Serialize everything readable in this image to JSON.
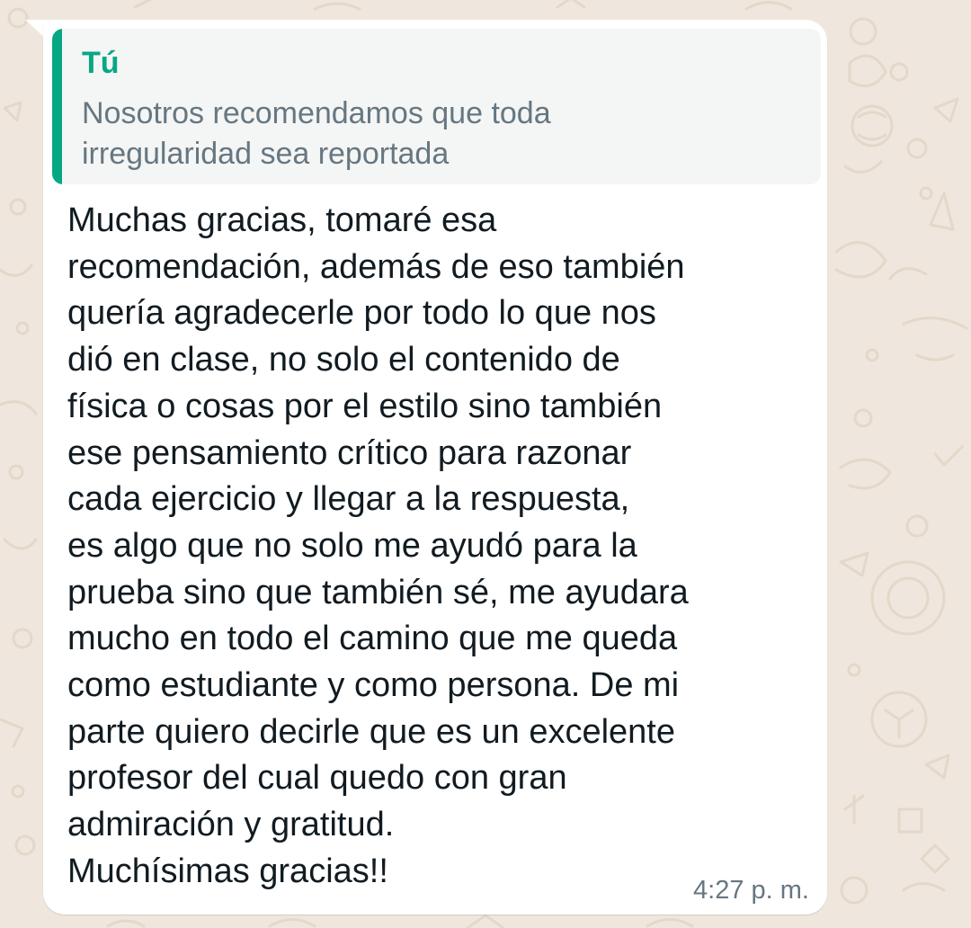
{
  "chat": {
    "bubble_color": "#ffffff",
    "wallpaper_color": "#efe7dd",
    "accent_color": "#06a884"
  },
  "quote": {
    "author": "Tú",
    "lines": [
      "Nosotros recomendamos que toda",
      "irregularidad sea reportada"
    ]
  },
  "message": {
    "lines": [
      "Muchas gracias, tomaré esa",
      "recomendación, además de eso también",
      "quería agradecerle por todo lo que nos",
      "dió en clase, no solo el contenido de",
      "física o cosas por el estilo sino también",
      "ese pensamiento crítico para razonar",
      "cada ejercicio y llegar a la respuesta,",
      "es algo que no solo me ayudó para la",
      "prueba sino que también sé, me ayudara",
      "mucho en todo el camino que me queda",
      "como estudiante y como persona. De mi",
      "parte quiero decirle que es un excelente",
      "profesor del cual quedo con gran",
      "admiración y gratitud.",
      "Muchísimas gracias!!"
    ],
    "time": "4:27 p. m."
  }
}
